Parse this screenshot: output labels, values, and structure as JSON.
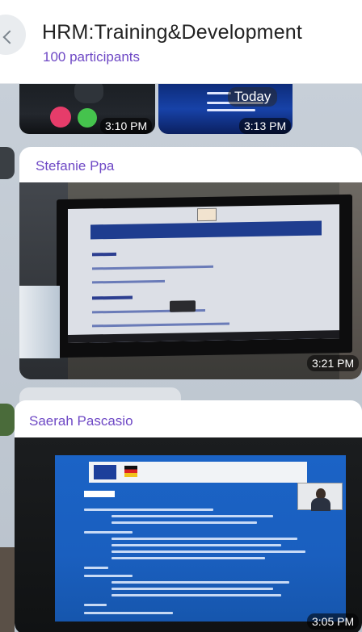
{
  "header": {
    "title": "HRM:Training&Development",
    "subtitle": "100 participants"
  },
  "top_media": {
    "date_pill": "Today",
    "left_time": "3:10 PM",
    "right_time": "3:13 PM"
  },
  "messages": [
    {
      "sender": "Stefanie Ppa",
      "time": "3:21 PM"
    },
    {
      "sender": "Saerah Pascasio",
      "time": "3:05 PM"
    }
  ],
  "colors": {
    "accent": "#6e48c5",
    "chat_background": "#c2cad3",
    "header_background": "#ffffff"
  }
}
